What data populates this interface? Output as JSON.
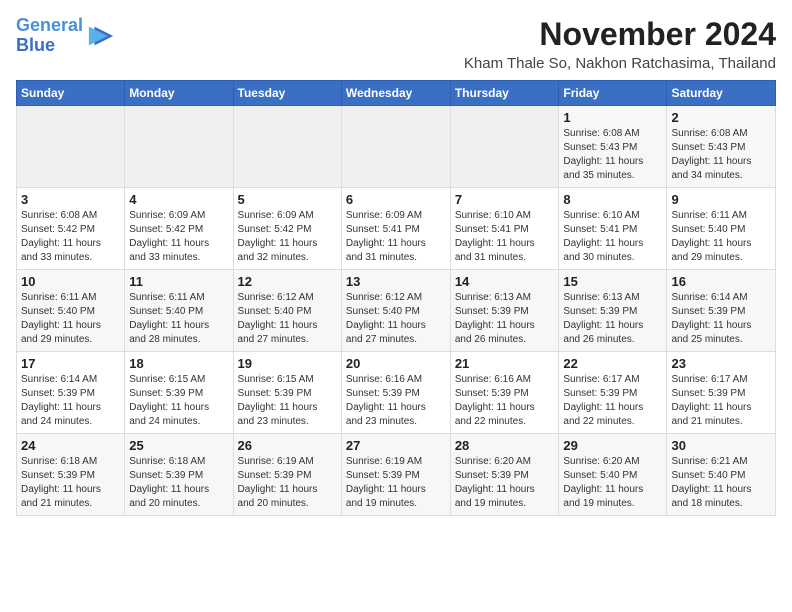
{
  "header": {
    "logo_line1": "General",
    "logo_line2": "Blue",
    "month": "November 2024",
    "location": "Kham Thale So, Nakhon Ratchasima, Thailand"
  },
  "weekdays": [
    "Sunday",
    "Monday",
    "Tuesday",
    "Wednesday",
    "Thursday",
    "Friday",
    "Saturday"
  ],
  "weeks": [
    [
      {
        "day": "",
        "info": ""
      },
      {
        "day": "",
        "info": ""
      },
      {
        "day": "",
        "info": ""
      },
      {
        "day": "",
        "info": ""
      },
      {
        "day": "",
        "info": ""
      },
      {
        "day": "1",
        "info": "Sunrise: 6:08 AM\nSunset: 5:43 PM\nDaylight: 11 hours\nand 35 minutes."
      },
      {
        "day": "2",
        "info": "Sunrise: 6:08 AM\nSunset: 5:43 PM\nDaylight: 11 hours\nand 34 minutes."
      }
    ],
    [
      {
        "day": "3",
        "info": "Sunrise: 6:08 AM\nSunset: 5:42 PM\nDaylight: 11 hours\nand 33 minutes."
      },
      {
        "day": "4",
        "info": "Sunrise: 6:09 AM\nSunset: 5:42 PM\nDaylight: 11 hours\nand 33 minutes."
      },
      {
        "day": "5",
        "info": "Sunrise: 6:09 AM\nSunset: 5:42 PM\nDaylight: 11 hours\nand 32 minutes."
      },
      {
        "day": "6",
        "info": "Sunrise: 6:09 AM\nSunset: 5:41 PM\nDaylight: 11 hours\nand 31 minutes."
      },
      {
        "day": "7",
        "info": "Sunrise: 6:10 AM\nSunset: 5:41 PM\nDaylight: 11 hours\nand 31 minutes."
      },
      {
        "day": "8",
        "info": "Sunrise: 6:10 AM\nSunset: 5:41 PM\nDaylight: 11 hours\nand 30 minutes."
      },
      {
        "day": "9",
        "info": "Sunrise: 6:11 AM\nSunset: 5:40 PM\nDaylight: 11 hours\nand 29 minutes."
      }
    ],
    [
      {
        "day": "10",
        "info": "Sunrise: 6:11 AM\nSunset: 5:40 PM\nDaylight: 11 hours\nand 29 minutes."
      },
      {
        "day": "11",
        "info": "Sunrise: 6:11 AM\nSunset: 5:40 PM\nDaylight: 11 hours\nand 28 minutes."
      },
      {
        "day": "12",
        "info": "Sunrise: 6:12 AM\nSunset: 5:40 PM\nDaylight: 11 hours\nand 27 minutes."
      },
      {
        "day": "13",
        "info": "Sunrise: 6:12 AM\nSunset: 5:40 PM\nDaylight: 11 hours\nand 27 minutes."
      },
      {
        "day": "14",
        "info": "Sunrise: 6:13 AM\nSunset: 5:39 PM\nDaylight: 11 hours\nand 26 minutes."
      },
      {
        "day": "15",
        "info": "Sunrise: 6:13 AM\nSunset: 5:39 PM\nDaylight: 11 hours\nand 26 minutes."
      },
      {
        "day": "16",
        "info": "Sunrise: 6:14 AM\nSunset: 5:39 PM\nDaylight: 11 hours\nand 25 minutes."
      }
    ],
    [
      {
        "day": "17",
        "info": "Sunrise: 6:14 AM\nSunset: 5:39 PM\nDaylight: 11 hours\nand 24 minutes."
      },
      {
        "day": "18",
        "info": "Sunrise: 6:15 AM\nSunset: 5:39 PM\nDaylight: 11 hours\nand 24 minutes."
      },
      {
        "day": "19",
        "info": "Sunrise: 6:15 AM\nSunset: 5:39 PM\nDaylight: 11 hours\nand 23 minutes."
      },
      {
        "day": "20",
        "info": "Sunrise: 6:16 AM\nSunset: 5:39 PM\nDaylight: 11 hours\nand 23 minutes."
      },
      {
        "day": "21",
        "info": "Sunrise: 6:16 AM\nSunset: 5:39 PM\nDaylight: 11 hours\nand 22 minutes."
      },
      {
        "day": "22",
        "info": "Sunrise: 6:17 AM\nSunset: 5:39 PM\nDaylight: 11 hours\nand 22 minutes."
      },
      {
        "day": "23",
        "info": "Sunrise: 6:17 AM\nSunset: 5:39 PM\nDaylight: 11 hours\nand 21 minutes."
      }
    ],
    [
      {
        "day": "24",
        "info": "Sunrise: 6:18 AM\nSunset: 5:39 PM\nDaylight: 11 hours\nand 21 minutes."
      },
      {
        "day": "25",
        "info": "Sunrise: 6:18 AM\nSunset: 5:39 PM\nDaylight: 11 hours\nand 20 minutes."
      },
      {
        "day": "26",
        "info": "Sunrise: 6:19 AM\nSunset: 5:39 PM\nDaylight: 11 hours\nand 20 minutes."
      },
      {
        "day": "27",
        "info": "Sunrise: 6:19 AM\nSunset: 5:39 PM\nDaylight: 11 hours\nand 19 minutes."
      },
      {
        "day": "28",
        "info": "Sunrise: 6:20 AM\nSunset: 5:39 PM\nDaylight: 11 hours\nand 19 minutes."
      },
      {
        "day": "29",
        "info": "Sunrise: 6:20 AM\nSunset: 5:40 PM\nDaylight: 11 hours\nand 19 minutes."
      },
      {
        "day": "30",
        "info": "Sunrise: 6:21 AM\nSunset: 5:40 PM\nDaylight: 11 hours\nand 18 minutes."
      }
    ]
  ]
}
